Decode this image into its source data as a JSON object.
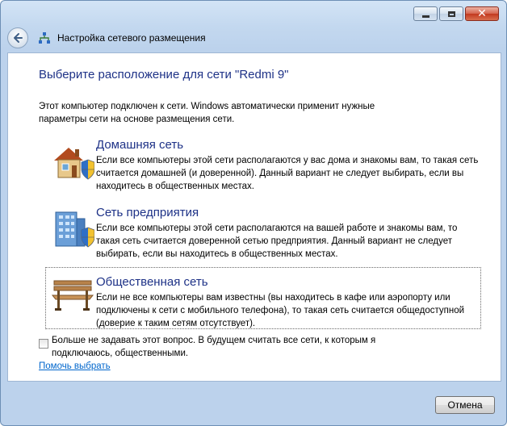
{
  "window": {
    "title": "Настройка сетевого размещения",
    "minimize_icon": "minimize-icon",
    "maximize_icon": "maximize-icon",
    "close_icon": "close-icon",
    "back_icon": "back-arrow-icon",
    "title_icon": "network-icon"
  },
  "main": {
    "heading": "Выберите расположение для сети \"Redmi 9\"",
    "description": "Этот компьютер подключен к сети. Windows автоматически применит нужные параметры сети на основе размещения сети.",
    "options": [
      {
        "title": "Домашняя сеть",
        "description": "Если все компьютеры этой сети располагаются у вас дома и знакомы вам, то такая сеть считается домашней (и доверенной). Данный вариант не следует выбирать, если вы находитесь в общественных местах.",
        "icon": "house-shield-icon",
        "selected": false
      },
      {
        "title": "Сеть предприятия",
        "description": "Если все компьютеры этой сети располагаются на вашей работе и знакомы вам, то такая сеть считается доверенной сетью предприятия. Данный вариант не следует выбирать, если вы находитесь в общественных местах.",
        "icon": "office-building-shield-icon",
        "selected": false
      },
      {
        "title": "Общественная сеть",
        "description": "Если не все компьютеры вам известны (вы находитесь в кафе или аэропорту или подключены к сети с мобильного телефона), то такая сеть считается общедоступной (доверие к таким сетям отсутствует).",
        "icon": "park-bench-icon",
        "selected": true
      }
    ],
    "checkbox": {
      "label": "Больше не задавать этот вопрос. В будущем считать все сети, к которым я подключаюсь, общественными.",
      "checked": false
    },
    "help_link": "Помочь выбрать"
  },
  "footer": {
    "cancel_label": "Отмена"
  },
  "colors": {
    "heading": "#1e3287",
    "link": "#0066cc",
    "frame": "#c3d8ef"
  }
}
